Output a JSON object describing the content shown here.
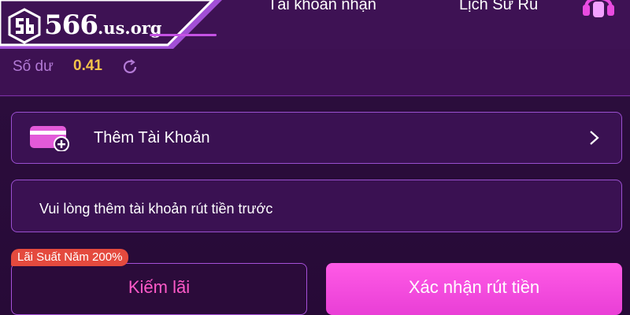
{
  "header": {
    "logo_text": "566",
    "logo_domain": ".us.org",
    "tabs": [
      {
        "label": "Tài khoản nhận"
      },
      {
        "label": "Lịch Sử Rú"
      }
    ]
  },
  "balance": {
    "label": "Số dư",
    "value": "0.41"
  },
  "add_account": {
    "label": "Thêm Tài Khoản"
  },
  "notice": {
    "text": "Vui lòng thêm tài khoản rút tiền trước"
  },
  "actions": {
    "badge": "Lãi Suất Năm 200%",
    "earn_label": "Kiếm lãi",
    "confirm_label": "Xác nhận rút tiền"
  },
  "colors": {
    "background": "#3a1150",
    "accent_pink": "#ff5ae6",
    "balance_gold": "#f5c24a",
    "badge_red": "#e44a3e",
    "border_purple": "#9a4fd0"
  },
  "icons": [
    "logo-mark-icon",
    "headset-icon",
    "refresh-icon",
    "wallet-add-icon",
    "chevron-right-icon"
  ]
}
